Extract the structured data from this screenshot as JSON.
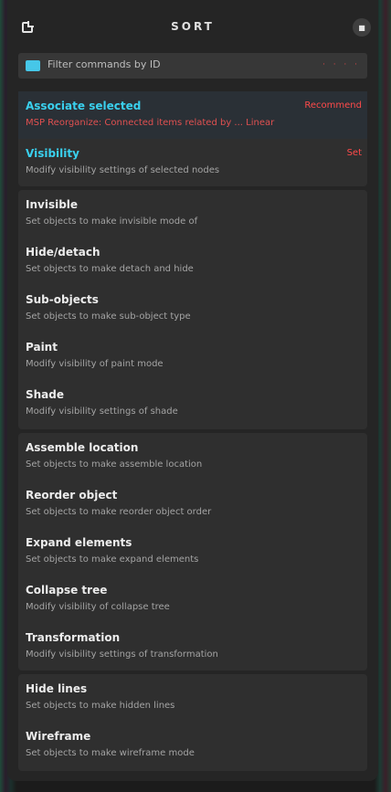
{
  "header": {
    "title": "SORT"
  },
  "search": {
    "accent_color": "#46c7e8",
    "text": "Filter commands by ID",
    "trail": "· · · ·"
  },
  "groups": [
    {
      "items": [
        {
          "name": "Associate selected",
          "desc": "MSP Reorganize: Connected items related by ... Linear",
          "tag": "Recommend"
        },
        {
          "name": "Visibility",
          "desc": "Modify visibility settings of selected nodes",
          "tag": "Set"
        }
      ]
    },
    {
      "items": [
        {
          "name": "Invisible",
          "desc": "Set objects to make invisible mode of"
        },
        {
          "name": "Hide/detach",
          "desc": "Set objects to make detach and hide"
        },
        {
          "name": "Sub-objects",
          "desc": "Set objects to make sub-object type"
        },
        {
          "name": "Paint",
          "desc": "Modify visibility of paint mode"
        },
        {
          "name": "Shade",
          "desc": "Modify visibility settings of shade"
        }
      ]
    },
    {
      "items": [
        {
          "name": "Assemble location",
          "desc": "Set objects to make assemble location"
        },
        {
          "name": "Reorder object",
          "desc": "Set objects to make reorder object order"
        },
        {
          "name": "Expand elements",
          "desc": "Set objects to make expand elements"
        },
        {
          "name": "Collapse tree",
          "desc": "Modify visibility of collapse tree"
        },
        {
          "name": "Transformation",
          "desc": "Modify visibility settings of transformation"
        }
      ]
    },
    {
      "items": [
        {
          "name": "Hide lines",
          "desc": "Set objects to make hidden lines"
        },
        {
          "name": "Wireframe",
          "desc": "Set objects to make wireframe mode"
        }
      ]
    }
  ]
}
